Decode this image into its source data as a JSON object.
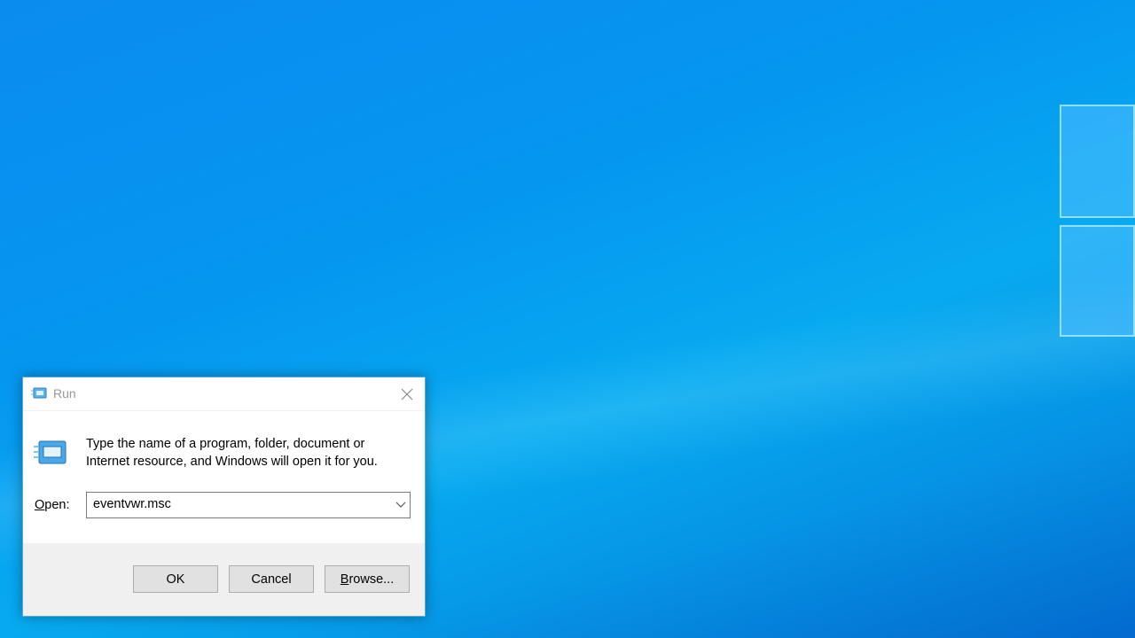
{
  "dialog": {
    "title": "Run",
    "description_line1": "Type the name of a program, folder, document or",
    "description_line2": "Internet resource, and Windows will open it for you.",
    "open_label_accel": "O",
    "open_label_rest": "pen:",
    "open_value": "eventvwr.msc",
    "buttons": {
      "ok": "OK",
      "cancel": "Cancel",
      "browse_accel": "B",
      "browse_rest": "rowse..."
    }
  },
  "colors": {
    "accent": "#0078d7",
    "desktop": "#0596f0"
  }
}
